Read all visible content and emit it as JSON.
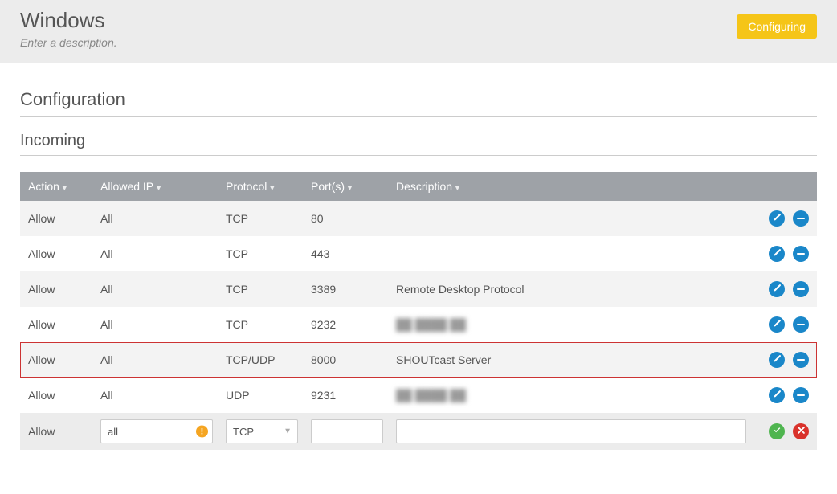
{
  "header": {
    "title": "Windows",
    "subtitle": "Enter a description.",
    "status": "Configuring"
  },
  "section": {
    "title": "Configuration",
    "subsection": "Incoming"
  },
  "columns": {
    "action": "Action",
    "allowed_ip": "Allowed IP",
    "protocol": "Protocol",
    "ports": "Port(s)",
    "description": "Description"
  },
  "rows": [
    {
      "action": "Allow",
      "ip": "All",
      "protocol": "TCP",
      "ports": "80",
      "description": "",
      "highlighted": false
    },
    {
      "action": "Allow",
      "ip": "All",
      "protocol": "TCP",
      "ports": "443",
      "description": "",
      "highlighted": false
    },
    {
      "action": "Allow",
      "ip": "All",
      "protocol": "TCP",
      "ports": "3389",
      "description": "Remote Desktop Protocol",
      "highlighted": false
    },
    {
      "action": "Allow",
      "ip": "All",
      "protocol": "TCP",
      "ports": "9232",
      "description": "██ ████ ██",
      "blurred": true,
      "highlighted": false
    },
    {
      "action": "Allow",
      "ip": "All",
      "protocol": "TCP/UDP",
      "ports": "8000",
      "description": "SHOUTcast Server",
      "highlighted": true
    },
    {
      "action": "Allow",
      "ip": "All",
      "protocol": "UDP",
      "ports": "9231",
      "description": "██ ████ ██",
      "blurred": true,
      "highlighted": false
    }
  ],
  "new_row": {
    "action": "Allow",
    "ip_value": "all",
    "protocol_value": "TCP",
    "ports_value": "",
    "description_value": ""
  }
}
